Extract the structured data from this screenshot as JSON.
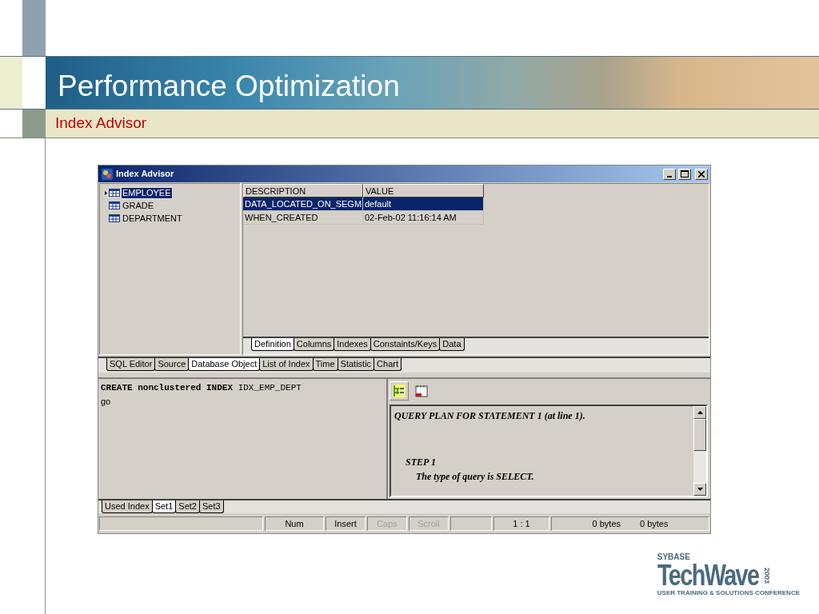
{
  "slide": {
    "title": "Performance Optimization",
    "subtitle": "Index Advisor"
  },
  "window": {
    "title": "Index Advisor"
  },
  "tree": [
    {
      "label": "EMPLOYEE",
      "selected": true
    },
    {
      "label": "GRADE",
      "selected": false
    },
    {
      "label": "DEPARTMENT",
      "selected": false
    }
  ],
  "grid": {
    "columns": [
      "DESCRIPTION",
      "VALUE"
    ],
    "rows": [
      {
        "cells": [
          "DATA_LOCATED_ON_SEGM",
          "default"
        ],
        "selected": true
      },
      {
        "cells": [
          "WHEN_CREATED",
          "02-Feb-02 11:16:14 AM"
        ],
        "selected": false
      }
    ]
  },
  "detail_tabs": [
    {
      "label": "Definition",
      "selected": true
    },
    {
      "label": "Columns",
      "selected": false
    },
    {
      "label": "Indexes",
      "selected": false
    },
    {
      "label": "Constaints/Keys",
      "selected": false
    },
    {
      "label": "Data",
      "selected": false
    }
  ],
  "main_tabs": [
    {
      "label": "SQL Editor",
      "selected": false
    },
    {
      "label": "Source",
      "selected": false
    },
    {
      "label": "Database Object",
      "selected": true
    },
    {
      "label": "List of Index",
      "selected": false
    },
    {
      "label": "Time",
      "selected": false
    },
    {
      "label": "Statistic",
      "selected": false
    },
    {
      "label": "Chart",
      "selected": false
    }
  ],
  "editor": {
    "lines": [
      {
        "kind": "code",
        "text": "**CREATE nonclustered INDEX** IDX_EMP_DEPT"
      },
      {
        "kind": "plain",
        "text": "go"
      }
    ]
  },
  "plan": {
    "lines": [
      {
        "kind": "heading",
        "text": "QUERY PLAN FOR STATEMENT 1 (at line 1)."
      },
      {
        "kind": "step",
        "text": "STEP 1"
      },
      {
        "kind": "detail",
        "text": "The type of query is SELECT."
      }
    ]
  },
  "result_tabs": [
    {
      "label": "Used Index",
      "selected": false
    },
    {
      "label": "Set1",
      "selected": true
    },
    {
      "label": "Set2",
      "selected": false
    },
    {
      "label": "Set3",
      "selected": false
    }
  ],
  "status_bar": [
    {
      "kind": "blank"
    },
    {
      "kind": "text",
      "text": "Num",
      "disabled": false
    },
    {
      "kind": "text",
      "text": "Insert",
      "disabled": false
    },
    {
      "kind": "text",
      "text": "Caps",
      "disabled": true
    },
    {
      "kind": "text",
      "text": "Scroll",
      "disabled": true
    },
    {
      "kind": "blank"
    },
    {
      "kind": "text",
      "text": "1 : 1",
      "disabled": false
    },
    {
      "kind": "bytes",
      "texts": [
        "0 bytes",
        "0 bytes"
      ]
    }
  ],
  "logo": {
    "brand": "SYBASE",
    "name": "TechWave",
    "year": "2003",
    "tagline": "USER TRAINING & SOLUTIONS CONFERENCE"
  }
}
